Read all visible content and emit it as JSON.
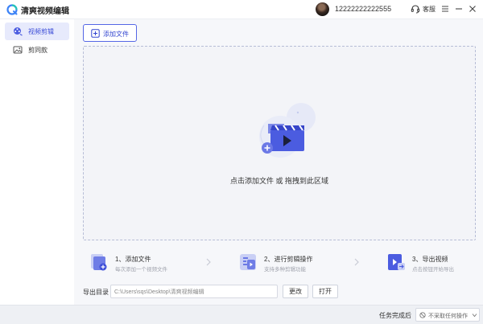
{
  "app": {
    "title": "清爽视频编辑"
  },
  "user": {
    "phone": "12222222222555"
  },
  "header": {
    "service_label": "客服"
  },
  "sidebar": {
    "items": [
      {
        "label": "视频剪辑",
        "icon": "film-reel-icon",
        "active": true
      },
      {
        "label": "剪同款",
        "icon": "image-template-icon",
        "active": false
      }
    ]
  },
  "toolbar": {
    "add_file_label": "添加文件"
  },
  "dropzone": {
    "text": "点击添加文件 或 拖拽到此区域"
  },
  "steps": [
    {
      "title": "1、添加文件",
      "subtitle": "每次添加一个视频文件",
      "icon": "add-file-step-icon"
    },
    {
      "title": "2、进行剪辑操作",
      "subtitle": "支持多种剪辑功能",
      "icon": "edit-step-icon"
    },
    {
      "title": "3、导出视频",
      "subtitle": "点击按钮开始导出",
      "icon": "export-step-icon"
    }
  ],
  "export": {
    "label": "导出目录",
    "path": "C:\\Users\\sqs\\Desktop\\清爽视频编辑",
    "change_label": "更改",
    "open_label": "打开"
  },
  "status": {
    "task_label": "任务完成后",
    "task_option": "不采取任何操作"
  },
  "colors": {
    "accent": "#4b5ce0",
    "accent_light": "#e7eafc",
    "background": "#f6f7fa"
  }
}
